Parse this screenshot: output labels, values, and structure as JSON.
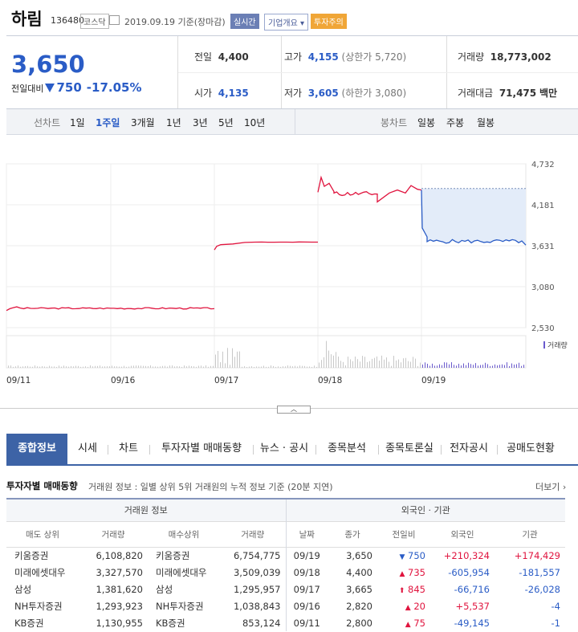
{
  "stock": {
    "name": "하림",
    "code": "136480",
    "market": "코스닥",
    "date_label": "2019.09.19 기준(장마감)",
    "badge_realtime": "실시간",
    "badge_company": "기업개요 ▾",
    "badge_warning": "투자주의"
  },
  "price": {
    "current": "3,650",
    "change_label": "전일대비",
    "change_value": "750",
    "change_pct": "-17.05%"
  },
  "info": {
    "prev_label": "전일",
    "prev": "4,400",
    "open_label": "시가",
    "open": "4,135",
    "high_label": "고가",
    "high": "4,155",
    "high_limit": "(상한가 5,720)",
    "low_label": "저가",
    "low": "3,605",
    "low_limit": "(하한가 3,080)",
    "volume_label": "거래량",
    "volume": "18,773,002",
    "amount_label": "거래대금",
    "amount": "71,475",
    "amount_unit": "백만"
  },
  "period_bar": {
    "line_label": "선차트",
    "line_options": [
      "1일",
      "1주일",
      "3개월",
      "1년",
      "3년",
      "5년",
      "10년"
    ],
    "active_line": "1주일",
    "candle_label": "봉차트",
    "candle_options": [
      "일봉",
      "주봉",
      "월봉"
    ]
  },
  "chart": {
    "y_ticks": [
      "4,732",
      "4,181",
      "3,631",
      "3,080",
      "2,530"
    ],
    "x_ticks": [
      "09/11",
      "09/16",
      "09/17",
      "09/18",
      "09/19"
    ],
    "volume_legend": "거래량",
    "up_color": "#e0143e",
    "down_color": "#2a5cc6",
    "toggle_icon": "chevron-up-icon"
  },
  "chart_data": {
    "type": "line",
    "x": [
      "09/11",
      "09/16",
      "09/17",
      "09/18",
      "09/19"
    ],
    "ylim": [
      2530,
      4732
    ],
    "series": [
      {
        "values": [
          2800,
          2820,
          3665,
          4400,
          3650
        ]
      }
    ],
    "prev_close_reference": 4400,
    "grid": true
  },
  "tabs": [
    "종합정보",
    "시세",
    "차트",
    "투자자별 매매동향",
    "뉴스 · 공시",
    "종목분석",
    "종목토론실",
    "전자공시",
    "공매도현황"
  ],
  "investor": {
    "title": "투자자별 매매동향",
    "desc": "거래원 정보 : 일별 상위 5위 거래원의 누적 정보 기준 (20분 지연)",
    "more": "더보기",
    "broker_header": "거래원 정보",
    "foreign_header": "외국인 · 기관",
    "cols": [
      "매도 상위",
      "거래량",
      "매수상위",
      "거래량",
      "날짜",
      "종가",
      "전일비",
      "외국인",
      "기관"
    ],
    "rows": [
      {
        "sell": "키움증권",
        "sell_vol": "6,108,820",
        "buy": "키움증권",
        "buy_vol": "6,754,775",
        "date": "09/19",
        "close": "3,650",
        "diff_sym": "▼",
        "diff": "750",
        "diff_dir": "dn",
        "foreign": "+210,324",
        "foreign_dir": "up",
        "inst": "+174,429",
        "inst_dir": "up"
      },
      {
        "sell": "미래에셋대우",
        "sell_vol": "3,327,570",
        "buy": "미래에셋대우",
        "buy_vol": "3,509,039",
        "date": "09/18",
        "close": "4,400",
        "diff_sym": "▲",
        "diff": "735",
        "diff_dir": "up",
        "foreign": "-605,954",
        "foreign_dir": "dn",
        "inst": "-181,557",
        "inst_dir": "dn"
      },
      {
        "sell": "삼성",
        "sell_vol": "1,381,620",
        "buy": "삼성",
        "buy_vol": "1,295,957",
        "date": "09/17",
        "close": "3,665",
        "diff_sym": "⬆",
        "diff": "845",
        "diff_dir": "up",
        "foreign": "-66,716",
        "foreign_dir": "dn",
        "inst": "-26,028",
        "inst_dir": "dn"
      },
      {
        "sell": "NH투자증권",
        "sell_vol": "1,293,923",
        "buy": "NH투자증권",
        "buy_vol": "1,038,843",
        "date": "09/16",
        "close": "2,820",
        "diff_sym": "▲",
        "diff": "20",
        "diff_dir": "up",
        "foreign": "+5,537",
        "foreign_dir": "up",
        "inst": "-4",
        "inst_dir": "dn"
      },
      {
        "sell": "KB증권",
        "sell_vol": "1,130,955",
        "buy": "KB증권",
        "buy_vol": "853,124",
        "date": "09/11",
        "close": "2,800",
        "diff_sym": "▲",
        "diff": "75",
        "diff_dir": "up",
        "foreign": "-49,145",
        "foreign_dir": "dn",
        "inst": "-1",
        "inst_dir": "dn"
      }
    ]
  }
}
